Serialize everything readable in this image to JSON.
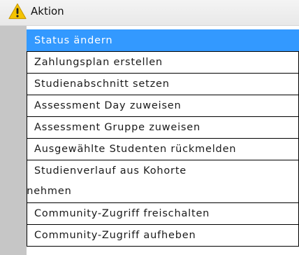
{
  "header": {
    "title": "Aktion",
    "icon": "warning-icon",
    "icon_color": "#f5c400"
  },
  "menu": {
    "selected_index": 0,
    "selected_color": "#3399ff",
    "items": [
      {
        "label": "Status ändern"
      },
      {
        "label": "Zahlungsplan erstellen"
      },
      {
        "label": "Studienabschnitt setzen"
      },
      {
        "label": "Assessment Day zuweisen"
      },
      {
        "label": "Assessment Gruppe zuweisen"
      },
      {
        "label": "Ausgewählte Studenten rückmelden"
      },
      {
        "label_line1": "Studienverlauf aus Kohorte",
        "label_line2": "übernehmen"
      },
      {
        "label": "Community-Zugriff freischalten"
      },
      {
        "label": "Community-Zugriff aufheben"
      }
    ]
  }
}
